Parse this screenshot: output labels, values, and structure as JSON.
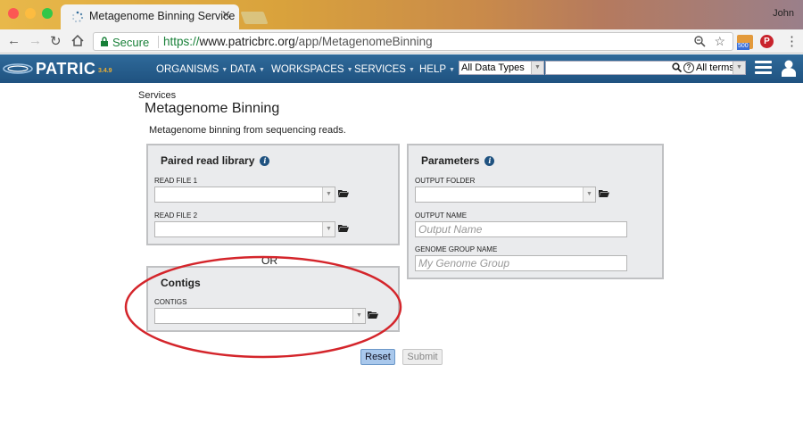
{
  "browser": {
    "tab_title": "Metagenome Binning Service",
    "tab_close": "✕",
    "profile_name": "John",
    "secure_label": "Secure",
    "url_scheme": "https://",
    "url_host": "www.patricbrc.org",
    "url_path": "/app/MetagenomeBinning",
    "extension_badge": "500",
    "extension_pinterest": "P",
    "colors": {
      "secure_green": "#188038",
      "chrome_gray": "#f2f2f2"
    }
  },
  "nav": {
    "logo": "PATRIC",
    "version": "3.4.9",
    "items": [
      "ORGANISMS",
      "DATA",
      "WORKSPACES",
      "SERVICES",
      "HELP"
    ],
    "data_type_selected": "All Data Types",
    "search_scope": "All terms",
    "colors": {
      "nav_blue": "#1f5280",
      "version_orange": "#f0b030"
    }
  },
  "page": {
    "breadcrumb": "Services",
    "title": "Metagenome Binning",
    "description": "Metagenome binning from sequencing reads.",
    "or_label": "OR"
  },
  "paired": {
    "title": "Paired read library",
    "read_file_1_label": "READ FILE 1",
    "read_file_2_label": "READ FILE 2"
  },
  "contigs": {
    "title": "Contigs",
    "contigs_label": "CONTIGS"
  },
  "parameters": {
    "title": "Parameters",
    "output_folder_label": "OUTPUT FOLDER",
    "output_name_label": "OUTPUT NAME",
    "output_name_placeholder": "Output Name",
    "genome_group_label": "GENOME GROUP NAME",
    "genome_group_placeholder": "My Genome Group"
  },
  "buttons": {
    "reset": "Reset",
    "submit": "Submit"
  },
  "annotation": {
    "highlight_color": "#d4252b"
  }
}
